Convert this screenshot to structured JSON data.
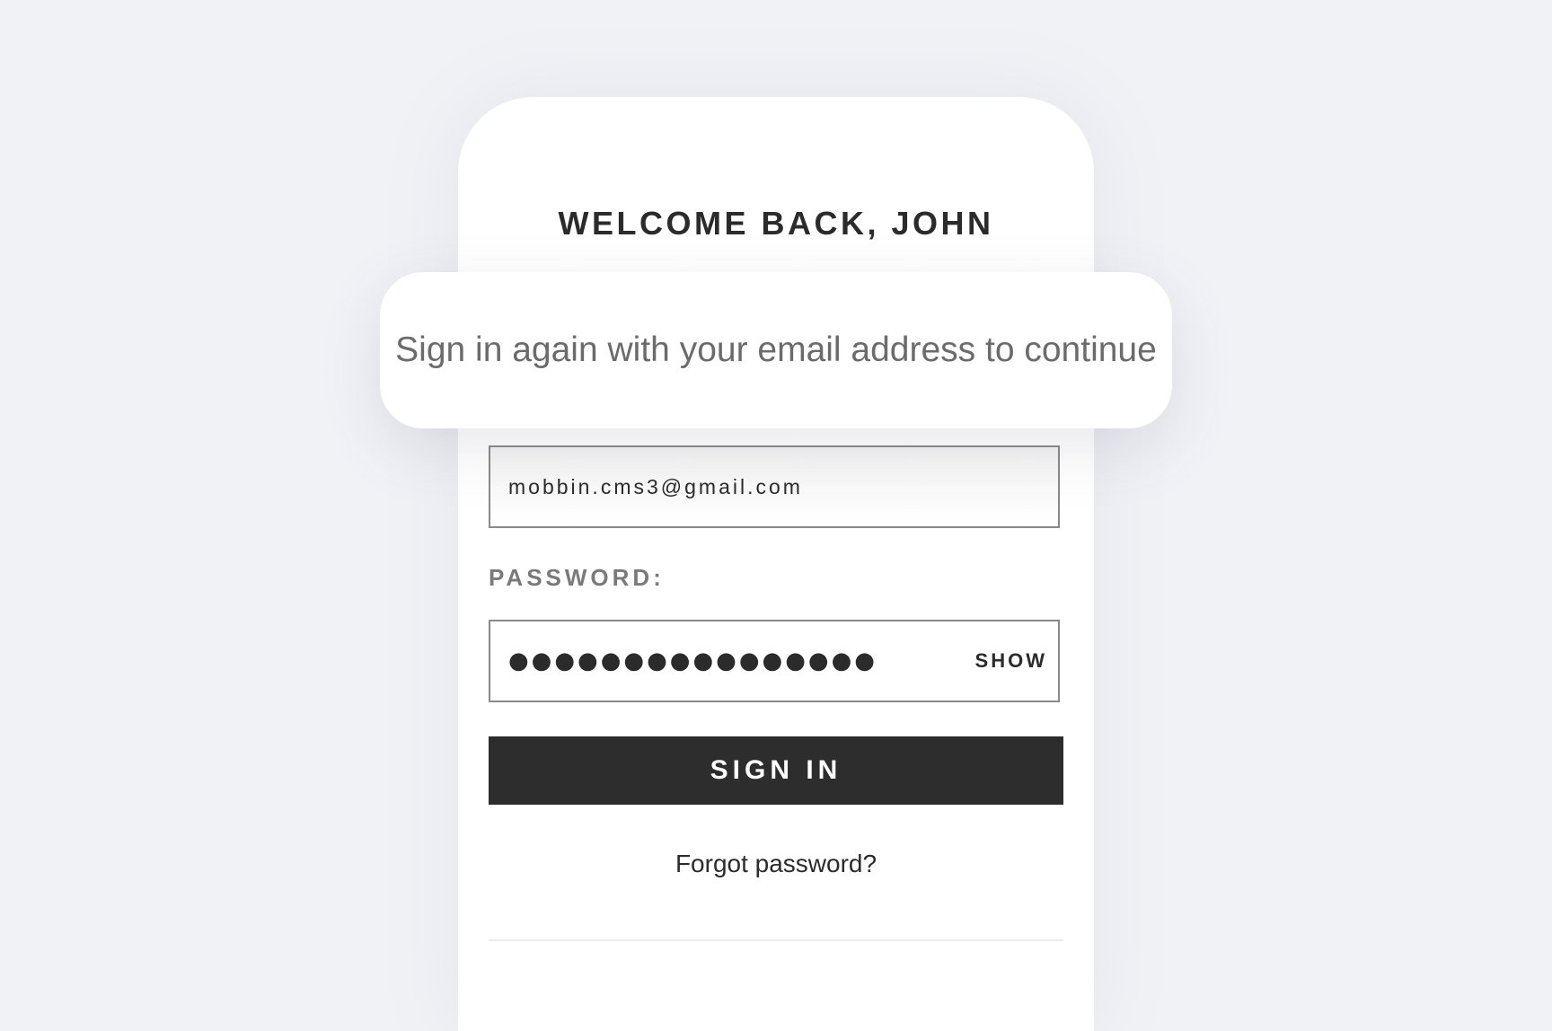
{
  "header": {
    "title": "WELCOME BACK, JOHN"
  },
  "callout": {
    "text": "Sign in again with your email address to continue"
  },
  "form": {
    "email_value": "mobbin.cms3@gmail.com",
    "password_label": "PASSWORD:",
    "password_mask": "●●●●●●●●●●●●●●●●",
    "show_label": "SHOW",
    "signin_label": "SIGN IN",
    "forgot_label": "Forgot password?"
  },
  "colors": {
    "background": "#f1f2f6",
    "card": "#ffffff",
    "primary_button": "#2d2d2d",
    "text_dark": "#2b2b2b",
    "text_muted": "#7a7a7a"
  }
}
